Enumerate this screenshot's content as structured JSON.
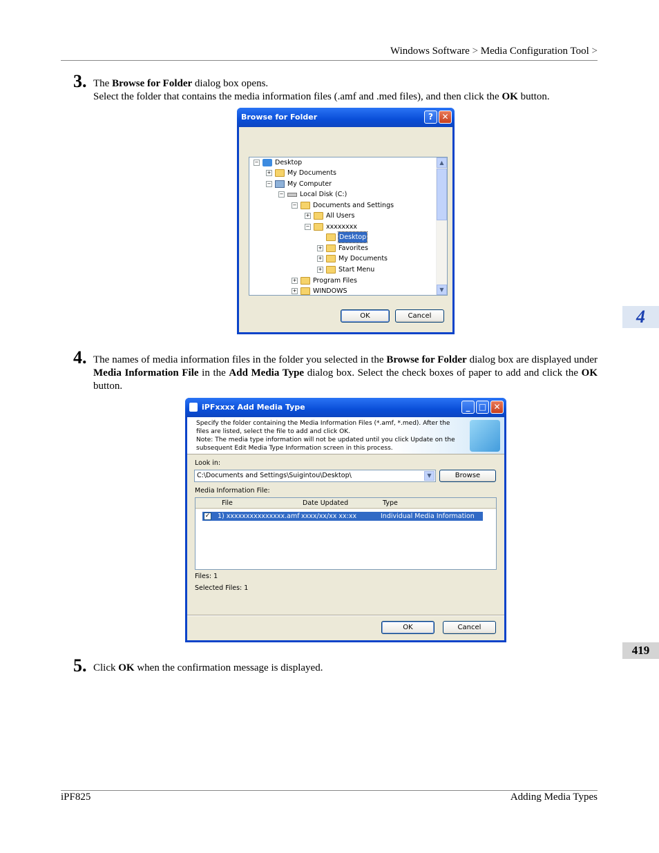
{
  "header": {
    "crumb_1": "Windows Software",
    "crumb_sep": ">",
    "crumb_2": "Media Configuration Tool"
  },
  "steps": [
    {
      "number": "3.",
      "line1_pre": "The ",
      "line1_bold": "Browse for Folder",
      "line1_post": " dialog box opens.",
      "line2_pre": "Select the folder that contains the media information files (.amf and .med files), and then click the ",
      "line2_bold": "OK",
      "line2_post": " button."
    },
    {
      "number": "4.",
      "t1": "The names of media information files in the folder you selected in the ",
      "b1": "Browse for Folder",
      "t2": " dialog box are displayed under ",
      "b2": "Media Information File",
      "t3": " in the ",
      "b3": "Add Media Type",
      "t4": " dialog box. Select the check boxes of paper to add and click the ",
      "b4": "OK",
      "t5": " button."
    },
    {
      "number": "5.",
      "pre": "Click ",
      "bold": "OK",
      "post": " when the confirmation message is displayed."
    }
  ],
  "browse_dialog": {
    "title": "Browse for Folder",
    "help_btn": "?",
    "close_btn": "✕",
    "tree": [
      {
        "label": "Desktop",
        "expander": "−"
      },
      {
        "label": "My Documents",
        "expander": "+"
      },
      {
        "label": "My Computer",
        "expander": "−"
      },
      {
        "label": "Local Disk (C:)",
        "expander": "−"
      },
      {
        "label": "Documents and Settings",
        "expander": "−"
      },
      {
        "label": "All Users",
        "expander": "+"
      },
      {
        "label": "xxxxxxxx",
        "expander": "−"
      },
      {
        "label": "Desktop",
        "expander": ""
      },
      {
        "label": "Favorites",
        "expander": "+"
      },
      {
        "label": "My Documents",
        "expander": "+"
      },
      {
        "label": "Start Menu",
        "expander": "+"
      },
      {
        "label": "Program Files",
        "expander": "+"
      },
      {
        "label": "WINDOWS",
        "expander": "+"
      }
    ],
    "scroll_up": "▲",
    "scroll_down": "▼",
    "ok_label": "OK",
    "cancel_label": "Cancel"
  },
  "add_media_dialog": {
    "title": "iPFxxxx Add Media Type",
    "minimize_btn": "_",
    "maximize_btn": "□",
    "close_btn": "✕",
    "info_line1": "Specify the folder containing the Media Information Files (*.amf, *.med). After the",
    "info_line2": "files are listed, select the file to add and click OK.",
    "info_line3": "Note: The media type information will not be updated until you click Update on the",
    "info_line4": "subsequent Edit Media Type Information screen in this process.",
    "look_in_label": "Look in:",
    "look_in_value": "C:\\Documents and Settings\\Suigintou\\Desktop\\",
    "dropdown_arrow": "▼",
    "browse_label": "Browse",
    "media_file_label": "Media Information File:",
    "columns": [
      "File",
      "Date Updated",
      "Type"
    ],
    "rows": [
      {
        "check": "✓",
        "file": "1) xxxxxxxxxxxxxxx.amf",
        "date": "xxxx/xx/xx xx:xx",
        "type": "Individual Media Information File"
      }
    ],
    "files_label": "Files: 1",
    "selected_label": "Selected Files: 1",
    "ok_label": "OK",
    "cancel_label": "Cancel"
  },
  "side_tab": "4",
  "page_number": "419",
  "footer": {
    "left": "iPF825",
    "right": "Adding Media Types"
  }
}
